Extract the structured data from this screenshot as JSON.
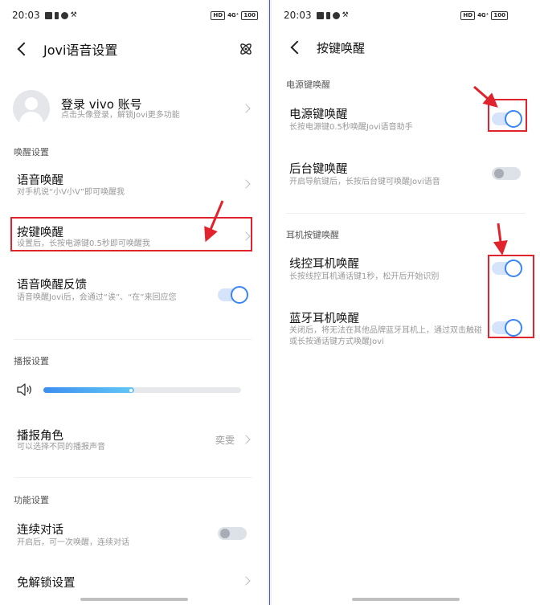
{
  "left": {
    "status": {
      "time": "20:03",
      "net": "4G⁺",
      "battery": "100",
      "hd": "HD"
    },
    "title": "Jovi语音设置",
    "account": {
      "title": "登录  vivo  账号",
      "subtitle": "点击头像登录，解锁Jovi更多功能"
    },
    "wake_section": "唤醒设置",
    "voice_wake": {
      "title": "语音唤醒",
      "subtitle": "对手机说“小V小V”即可唤醒我"
    },
    "key_wake": {
      "title": "按键唤醒",
      "subtitle": "设置后，长按电源键0.5秒即可唤醒我"
    },
    "wake_feedback": {
      "title": "语音唤醒反馈",
      "subtitle": "语音唤醒Jovi后，会通过“诶”、“在”来回应您",
      "on": true
    },
    "broadcast_section": "播报设置",
    "volume_level": 0.46,
    "role": {
      "title": "播报角色",
      "subtitle": "可以选择不同的播报声音",
      "value": "奕雯"
    },
    "feature_section": "功能设置",
    "continuous": {
      "title": "连续对话",
      "subtitle": "开启后，可一次唤醒，连续对话",
      "on": false
    },
    "unlock_free": {
      "title": "免解锁设置"
    }
  },
  "right": {
    "status": {
      "time": "20:03",
      "net": "4G⁺",
      "battery": "100",
      "hd": "HD"
    },
    "title": "按键唤醒",
    "power_section": "电源键唤醒",
    "power_wake": {
      "title": "电源键唤醒",
      "subtitle": "长按电源键0.5秒唤醒Jovi语音助手",
      "on": true
    },
    "back_key_wake": {
      "title": "后台键唤醒",
      "subtitle": "开启导航键后，长按后台键可唤醒Jovi语音",
      "on": false
    },
    "earphone_section": "耳机按键唤醒",
    "wired_wake": {
      "title": "线控耳机唤醒",
      "subtitle": "长按线控耳机通话键1秒，松开后开始识别",
      "on": true
    },
    "bt_wake": {
      "title": "蓝牙耳机唤醒",
      "subtitle": "关闭后，将无法在其他品牌蓝牙耳机上，通过双击触碰或长按通话键方式唤醒Jovi",
      "on": true
    }
  },
  "colors": {
    "accent": "#3a86f7",
    "annotation": "#e0232c"
  },
  "icons": [
    "back-arrow-icon",
    "atom-icon",
    "avatar-icon",
    "volume-icon",
    "chevron-right-icon"
  ]
}
